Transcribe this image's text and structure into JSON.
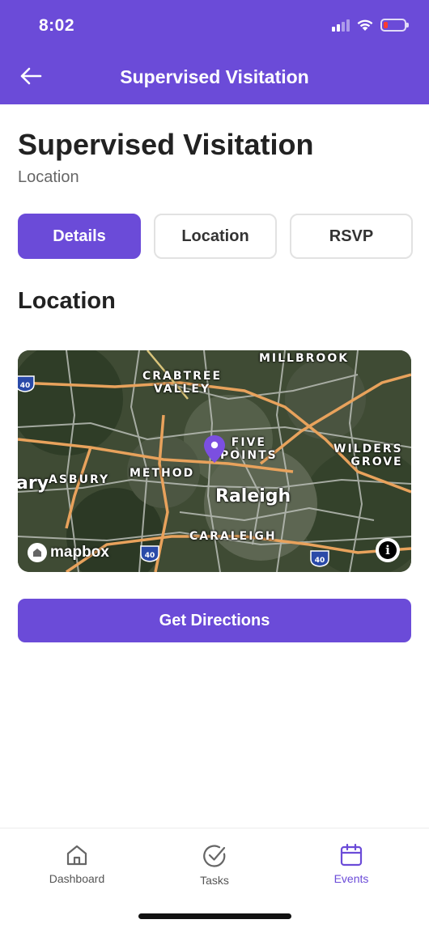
{
  "status_bar": {
    "time": "8:02",
    "battery_color": "#ff3b30"
  },
  "header": {
    "title": "Supervised Visitation",
    "back_icon": "arrow-left-icon",
    "background": "#6b4bd8"
  },
  "page": {
    "title": "Supervised Visitation",
    "subtitle": "Location"
  },
  "tabs": [
    {
      "label": "Details",
      "active": true
    },
    {
      "label": "Location",
      "active": false
    },
    {
      "label": "RSVP",
      "active": false
    }
  ],
  "section": {
    "title": "Location"
  },
  "map": {
    "labels": {
      "millbrook": "MILLBROOK",
      "crabtree": "CRABTREE\nVALLEY",
      "five_points": "FIVE\nPOINTS",
      "wilders_grove": "WILDERS\nGROVE",
      "cary": "ary",
      "asbury": "ASBURY",
      "method": "METHOD",
      "raleigh": "Raleigh",
      "caraleigh": "CARALEIGH"
    },
    "highway_label": "40",
    "attribution": "mapbox",
    "info_glyph": "i",
    "pin_color": "#7b4fe0"
  },
  "cta": {
    "label": "Get Directions"
  },
  "tabbar": {
    "items": [
      {
        "label": "Dashboard",
        "icon": "home-icon",
        "active": false
      },
      {
        "label": "Tasks",
        "icon": "check-circle-icon",
        "active": false
      },
      {
        "label": "Events",
        "icon": "calendar-icon",
        "active": true
      }
    ]
  },
  "colors": {
    "accent": "#6b4bd8",
    "inactive": "#555555"
  }
}
